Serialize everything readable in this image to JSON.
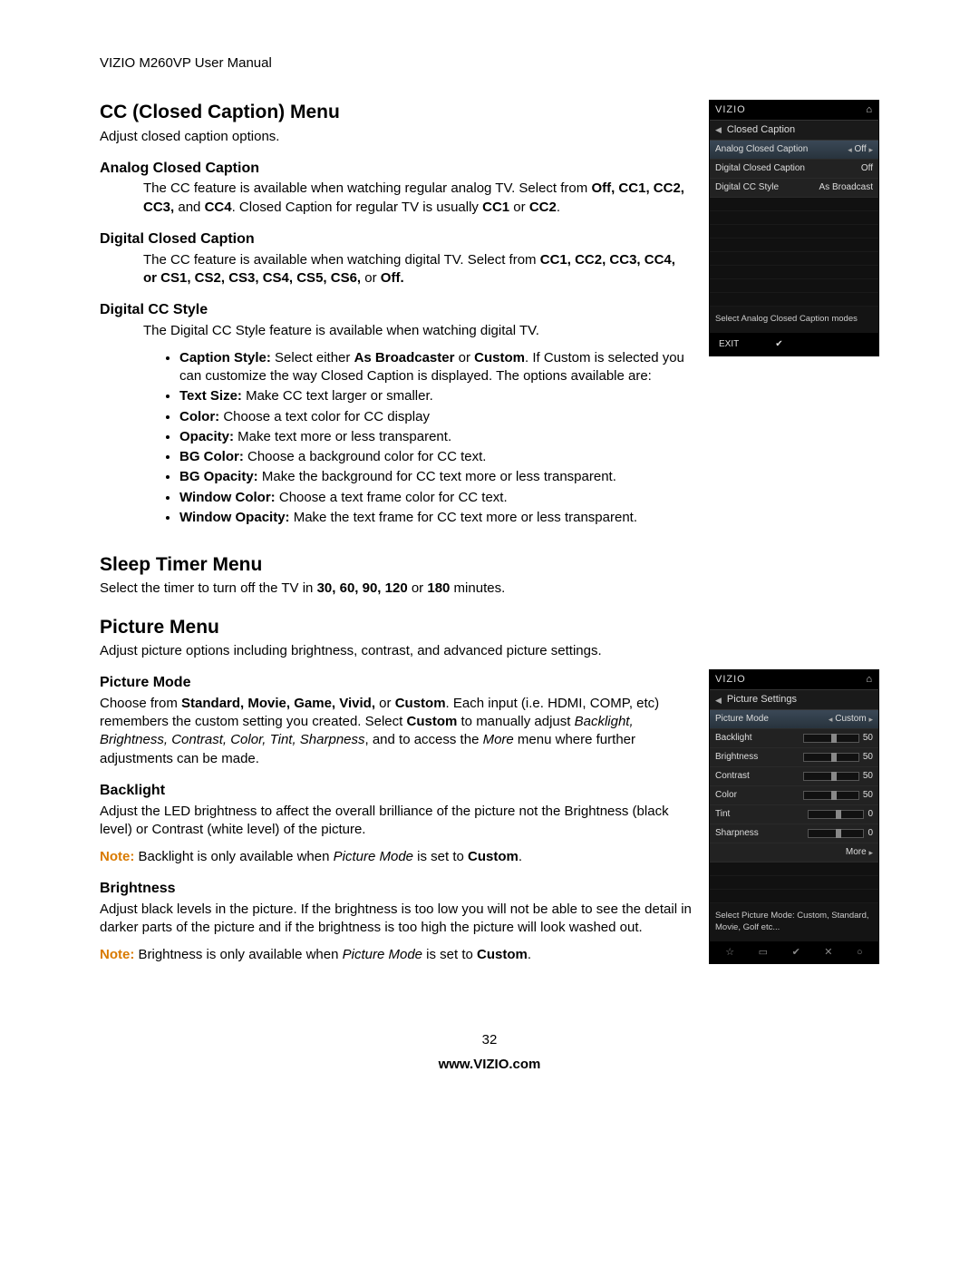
{
  "header": "VIZIO M260VP User Manual",
  "page_number": "32",
  "footer_url": "www.VIZIO.com",
  "cc": {
    "title": "CC (Closed Caption) Menu",
    "intro": "Adjust closed caption options.",
    "analog": {
      "title": "Analog Closed Caption",
      "body_pre": "The CC feature is available when watching regular analog TV. Select from ",
      "bold1": "Off, CC1, CC2, CC3,",
      "mid": " and ",
      "bold2": "CC4",
      "body_post": ". Closed Caption for regular TV is usually ",
      "bold3": "CC1",
      "or": " or ",
      "bold4": "CC2",
      "end": "."
    },
    "digital": {
      "title": "Digital Closed Caption",
      "body_pre": "The CC feature is available when watching digital TV. Select from ",
      "bold": "CC1, CC2, CC3, CC4, or CS1, CS2, CS3, CS4, CS5, CS6,",
      "post": " or ",
      "bold2": "Off."
    },
    "style": {
      "title": "Digital CC Style",
      "intro": "The Digital CC Style feature is available when watching digital TV.",
      "b1_label": "Caption Style:",
      "b1_text": " Select either ",
      "b1_bold1": "As Broadcaster",
      "b1_or": " or ",
      "b1_bold2": "Custom",
      "b1_post": ". If Custom is selected you can customize the way Closed Caption is displayed. The options available are:",
      "b2_label": "Text Size:",
      "b2_text": " Make CC text larger or smaller.",
      "b3_label": "Color:",
      "b3_text": " Choose a text color for CC display",
      "b4_label": "Opacity:",
      "b4_text": " Make text more or less transparent.",
      "b5_label": "BG Color:",
      "b5_text": " Choose a background color for CC text.",
      "b6_label": "BG Opacity:",
      "b6_text": " Make the background for CC text more or less transparent.",
      "b7_label": "Window Color:",
      "b7_text": " Choose a text frame color for CC text.",
      "b8_label": "Window Opacity:",
      "b8_text": " Make the text frame for CC text more or less transparent."
    }
  },
  "sleep": {
    "title": "Sleep Timer Menu",
    "pre": "Select the timer to turn off the TV in ",
    "bold": "30, 60, 90, 120",
    "mid": " or ",
    "bold2": "180",
    "post": " minutes."
  },
  "picture": {
    "title": "Picture Menu",
    "intro": "Adjust picture options including brightness, contrast, and advanced picture settings.",
    "mode": {
      "title": "Picture Mode",
      "pre": "Choose from ",
      "bold": "Standard, Movie, Game, Vivid,",
      "mid": " or ",
      "bold2": "Custom",
      "post": ". Each input (i.e. HDMI, COMP, etc) remembers the custom setting you created. Select ",
      "bold3": "Custom",
      "post2": " to manually adjust ",
      "italics": "Backlight, Brightness, Contrast, Color, Tint, Sharpness",
      "post3": ", and to access the ",
      "italics2": "More",
      "post4": " menu where further adjustments can be made."
    },
    "backlight": {
      "title": "Backlight",
      "body": "Adjust the LED brightness to affect the overall brilliance of the picture not the Brightness (black level) or Contrast (white level) of the picture.",
      "note_label": "Note:",
      "note_pre": " Backlight is only available when ",
      "note_i": "Picture Mode",
      "note_mid": " is set to ",
      "note_b": "Custom",
      "note_end": "."
    },
    "brightness": {
      "title": "Brightness",
      "body": "Adjust black levels in the picture. If the brightness is too low you will not be able to see the detail in darker parts of the picture and if the brightness is too high the picture will look washed out.",
      "note_label": "Note:",
      "note_pre": " Brightness is only available when ",
      "note_i": "Picture Mode",
      "note_mid": " is set to ",
      "note_b": "Custom",
      "note_end": "."
    }
  },
  "osd_cc": {
    "brand": "VIZIO",
    "title": "Closed Caption",
    "rows": [
      {
        "label": "Analog Closed Caption",
        "value": "Off",
        "hl": true,
        "arrows": true
      },
      {
        "label": "Digital Closed Caption",
        "value": "Off"
      },
      {
        "label": "Digital CC Style",
        "value": "As Broadcast"
      }
    ],
    "help": "Select Analog Closed Caption modes",
    "exit": "EXIT"
  },
  "osd_pic": {
    "brand": "VIZIO",
    "title": "Picture Settings",
    "rows": [
      {
        "label": "Picture Mode",
        "value": "Custom",
        "hl": true,
        "arrows": true
      },
      {
        "label": "Backlight",
        "value": "50",
        "slider": 50
      },
      {
        "label": "Brightness",
        "value": "50",
        "slider": 50
      },
      {
        "label": "Contrast",
        "value": "50",
        "slider": 50
      },
      {
        "label": "Color",
        "value": "50",
        "slider": 50
      },
      {
        "label": "Tint",
        "value": "0",
        "slider": 50
      },
      {
        "label": "Sharpness",
        "value": "0",
        "slider": 50
      }
    ],
    "more": "More",
    "help": "Select Picture Mode: Custom, Standard, Movie, Golf etc..."
  }
}
